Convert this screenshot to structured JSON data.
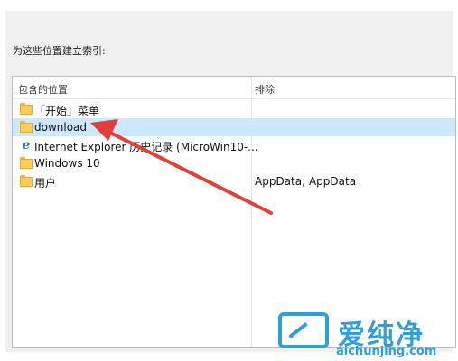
{
  "dialog": {
    "caption": "为这些位置建立索引:"
  },
  "list": {
    "columns": [
      "包含的位置",
      "排除"
    ],
    "rows": [
      {
        "name": "「开始」菜单",
        "exclude": "",
        "icon": "folder-icon",
        "selected": false
      },
      {
        "name": "download",
        "exclude": "",
        "icon": "folder-icon",
        "selected": true
      },
      {
        "name": "Internet Explorer 历史记录 (MicroWin10-...",
        "exclude": "",
        "icon": "ie-icon",
        "selected": false
      },
      {
        "name": "Windows 10",
        "exclude": "",
        "icon": "folder-icon",
        "selected": false
      },
      {
        "name": "用户",
        "exclude": "AppData; AppData",
        "icon": "folder-icon",
        "selected": false
      }
    ]
  },
  "colors": {
    "selection": "#cce8ff",
    "arrow": "#e0403a",
    "watermark": "#2f9fd8"
  },
  "watermark": {
    "title": "爱纯净",
    "url": "aichunjing.com"
  }
}
